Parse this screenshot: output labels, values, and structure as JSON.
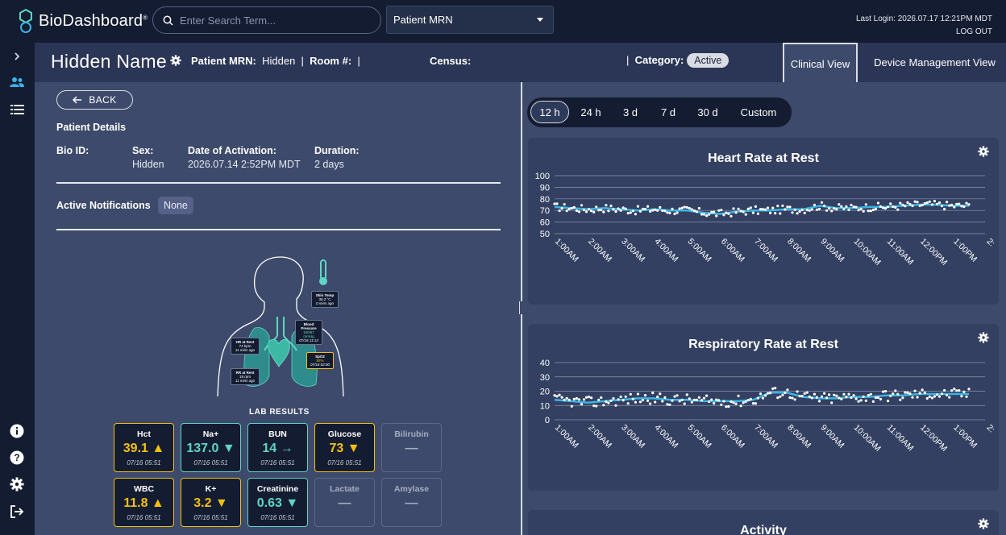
{
  "app": {
    "brand": "BioDashboard",
    "brand_mark": "®"
  },
  "topbar": {
    "search_placeholder": "Enter Search Term...",
    "search_type": "Patient MRN",
    "last_login": "Last Login: 2026.07.17 12:21PM MDT",
    "logout": "LOG OUT"
  },
  "patient": {
    "name": "Hidden Name",
    "mrn_label": "Patient MRN:",
    "mrn_value": "Hidden",
    "room_label": "Room #:",
    "room_value": "",
    "census_label": "Census:",
    "category_label": "Category:",
    "category_value": "Active"
  },
  "tabs": {
    "clinical": "Clinical View",
    "device": "Device Management View"
  },
  "details": {
    "back": "BACK",
    "title": "Patient Details",
    "bio_id_label": "Bio ID:",
    "bio_id_value": "",
    "sex_label": "Sex:",
    "sex_value": "Hidden",
    "activation_label": "Date of Activation:",
    "activation_value": "2026.07.14 2:52PM MDT",
    "duration_label": "Duration:",
    "duration_value": "2 days",
    "notifications_label": "Active Notifications",
    "notifications_value": "None"
  },
  "body_callouts": {
    "skin": {
      "title": "Skin Temp",
      "value": "36.2 °C",
      "time": "0 mins ago"
    },
    "bp": {
      "title": "Blood Pressure",
      "value": "100/67 mmHg",
      "time": "07/16 11:13"
    },
    "hr": {
      "title": "HR at Rest",
      "value": "74 bpm",
      "time": "11 mins ago"
    },
    "spo2": {
      "title": "SpO2",
      "value": "92%",
      "time": "07/16 02:00"
    },
    "rr": {
      "title": "RR at Rest",
      "value": "18 rpm",
      "time": "11 mins ago"
    }
  },
  "labs": {
    "title": "LAB RESULTS",
    "items": [
      {
        "name": "Hct",
        "value": "39.1 ▲",
        "time": "07/16 05:51",
        "status": "yellow"
      },
      {
        "name": "Na+",
        "value": "137.0 ▼",
        "time": "07/16 05:51",
        "status": "green"
      },
      {
        "name": "BUN",
        "value": "14 →",
        "time": "07/16 05:51",
        "status": "green"
      },
      {
        "name": "Glucose",
        "value": "73 ▼",
        "time": "07/16 05:51",
        "status": "yellow"
      },
      {
        "name": "Bilirubin",
        "value": "—",
        "time": "",
        "status": "gray"
      },
      {
        "name": "WBC",
        "value": "11.8 ▲",
        "time": "07/16 05:51",
        "status": "yellow"
      },
      {
        "name": "K+",
        "value": "3.2 ▼",
        "time": "07/16 05:51",
        "status": "yellow"
      },
      {
        "name": "Creatinine",
        "value": "0.63 ▼",
        "time": "07/16 05:51",
        "status": "green"
      },
      {
        "name": "Lactate",
        "value": "—",
        "time": "",
        "status": "gray"
      },
      {
        "name": "Amylase",
        "value": "—",
        "time": "",
        "status": "gray"
      }
    ]
  },
  "ranges": [
    "12 h",
    "24 h",
    "3 d",
    "7 d",
    "30 d",
    "Custom"
  ],
  "selected_range": "12 h",
  "colors": {
    "accent_teal": "#5fd6c2",
    "warn_yellow": "#f2c10f",
    "trend_line": "#3ab4e6"
  },
  "chart_data": [
    {
      "type": "scatter",
      "title": "Heart Rate at Rest",
      "x_tick_labels": [
        "1:00AM",
        "2:00AM",
        "3:00AM",
        "4:00AM",
        "5:00AM",
        "6:00AM",
        "7:00AM",
        "8:00AM",
        "9:00AM",
        "10:00AM",
        "11:00AM",
        "12:00PM",
        "1:00PM",
        "2:"
      ],
      "yticks": [
        50,
        60,
        70,
        80,
        90,
        100
      ],
      "ylim": [
        50,
        100
      ],
      "grid": true,
      "trend": [
        73,
        72,
        71,
        72,
        71,
        70,
        71,
        70,
        70,
        68,
        67,
        69,
        70,
        70,
        71,
        71,
        74,
        72,
        72,
        73,
        73,
        74,
        75,
        75,
        74,
        74
      ]
    },
    {
      "type": "scatter",
      "title": "Respiratory Rate at Rest",
      "x_tick_labels": [
        "1:00AM",
        "2:00AM",
        "3:00AM",
        "4:00AM",
        "5:00AM",
        "6:00AM",
        "7:00AM",
        "8:00AM",
        "9:00AM",
        "10:00AM",
        "11:00AM",
        "12:00PM",
        "1:00PM",
        "2:"
      ],
      "yticks": [
        0,
        10,
        20,
        30,
        40
      ],
      "ylim": [
        0,
        40
      ],
      "grid": true,
      "trend": [
        14,
        13,
        12,
        13,
        14,
        15,
        15,
        14,
        14,
        13,
        13,
        13,
        14,
        19,
        19,
        16,
        15,
        15,
        16,
        16,
        17,
        17,
        18,
        18,
        18,
        18
      ]
    },
    {
      "type": "line",
      "title": "Activity"
    }
  ]
}
